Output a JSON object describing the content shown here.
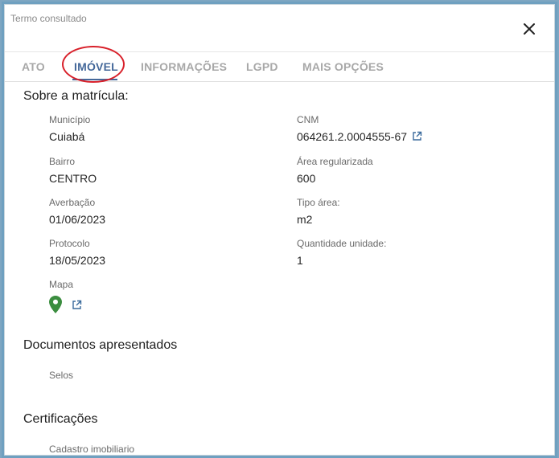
{
  "dialog": {
    "title": "Termo consultado",
    "close_icon": "close-icon"
  },
  "tabs": [
    {
      "label": "ATO",
      "active": false
    },
    {
      "label": "IMÓVEL",
      "active": true
    },
    {
      "label": "INFORMAÇÕES",
      "active": false
    },
    {
      "label": "LGPD",
      "active": false
    },
    {
      "label": "MAIS OPÇÕES",
      "active": false
    }
  ],
  "sections": {
    "matricula": {
      "title": "Sobre a matrícula:",
      "fields": {
        "municipio": {
          "label": "Município",
          "value": "Cuiabá"
        },
        "cnm": {
          "label": "CNM",
          "value": "064261.2.0004555-67",
          "icon": "external-link-icon"
        },
        "bairro": {
          "label": "Bairro",
          "value": "CENTRO"
        },
        "area_regularizada": {
          "label": "Área regularizada",
          "value": "600"
        },
        "averbacao": {
          "label": "Averbação",
          "value": "01/06/2023"
        },
        "tipo_area": {
          "label": "Tipo área:",
          "value": "m2"
        },
        "protocolo": {
          "label": "Protocolo",
          "value": "18/05/2023"
        },
        "quantidade_unidade": {
          "label": "Quantidade unidade:",
          "value": "1"
        },
        "mapa": {
          "label": "Mapa",
          "icon": "map-pin-icon",
          "link_icon": "external-link-icon"
        }
      }
    },
    "documentos": {
      "title": "Documentos apresentados",
      "fields": {
        "selos": {
          "label": "Selos"
        }
      }
    },
    "certificacoes": {
      "title": "Certificações",
      "fields": {
        "cadastro": {
          "label": "Cadastro imobiliario"
        }
      }
    }
  },
  "colors": {
    "accent": "#44689a",
    "highlight": "#d8202a",
    "pin": "#3b8d3f",
    "link": "#3a6a9c"
  }
}
